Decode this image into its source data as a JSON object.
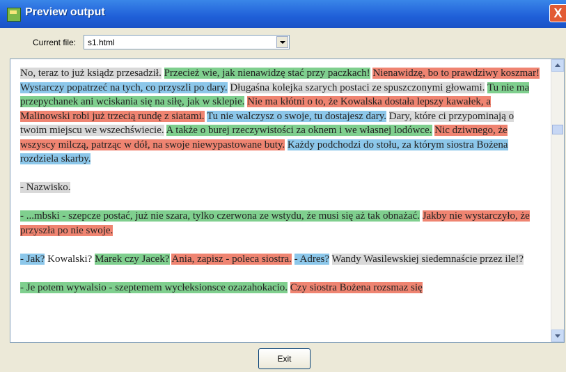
{
  "window": {
    "title": "Preview output",
    "close_label": "X"
  },
  "file_selector": {
    "label": "Current file:",
    "value": "s1.html"
  },
  "preview": {
    "paragraphs": [
      {
        "segments": [
          {
            "text": "No, teraz to już ksiądz przesadził.",
            "color": "gray"
          },
          {
            "text": "Przecież wie, jak nienawidzę stać przy paczkach!",
            "color": "green"
          },
          {
            "text": "Nienawidzę, bo to prawdziwy koszmar!",
            "color": "red"
          },
          {
            "text": "Wystarczy popatrzeć na tych, co przyszli po dary.",
            "color": "blue"
          },
          {
            "text": "Długaśna kolejka szarych postaci ze spuszczonymi głowami.",
            "color": "gray"
          },
          {
            "text": "Tu nie ma przepychanek ani wciskania się na siłę, jak w sklepie.",
            "color": "green"
          },
          {
            "text": "Nie ma kłótni o to, że Kowalska dostała lepszy kawałek, a Malinowski robi już trzecią rundę z siatami.",
            "color": "red"
          },
          {
            "text": "Tu nie walczysz o swoje, tu dostajesz dary.",
            "color": "blue"
          },
          {
            "text": "Dary, które ci przypominają o twoim miejscu we wszechświecie.",
            "color": "gray"
          },
          {
            "text": "A także o burej rzeczywistości za oknem i we własnej lodówce.",
            "color": "green"
          },
          {
            "text": "Nic dziwnego, że wszyscy milczą, patrząc w dół, na swoje niewypastowane buty.",
            "color": "red"
          },
          {
            "text": "Każdy podchodzi do stołu, za którym siostra Bożena rozdziela skarby.",
            "color": "blue"
          }
        ]
      },
      {
        "segments": [
          {
            "text": "- Nazwisko.",
            "color": "gray"
          }
        ]
      },
      {
        "segments": [
          {
            "text": "- ...mbski - szepcze postać, już nie szara, tylko czerwona ze wstydu, że musi się aż tak obnażać.",
            "color": "green"
          },
          {
            "text": "Jakby nie wystarczyło, że przyszła po nie swoje.",
            "color": "red"
          }
        ]
      },
      {
        "segments": [
          {
            "text": "- Jak?",
            "color": "blue"
          },
          {
            "text": "Kowalski?",
            "color": "none"
          },
          {
            "text": "Marek czy Jacek?",
            "color": "green"
          },
          {
            "text": "Ania, zapisz - poleca siostra.",
            "color": "red"
          },
          {
            "text": "- Adres?",
            "color": "blue"
          },
          {
            "text": "Wandy Wasilewskiej siedemnaście przez ile!?",
            "color": "gray"
          }
        ]
      },
      {
        "segments": [
          {
            "text": "- Je potem wywalsio - szeptemem wycłeksionsce ozazahokacio.",
            "color": "green"
          },
          {
            "text": "Czy siostra Bożena rozsmaz się",
            "color": "red"
          }
        ]
      }
    ]
  },
  "buttons": {
    "exit_label": "Exit"
  },
  "colors": {
    "green": "#7fcf8e",
    "red": "#ef8471",
    "blue": "#8cc7ea",
    "gray": "#d9d9d9"
  }
}
